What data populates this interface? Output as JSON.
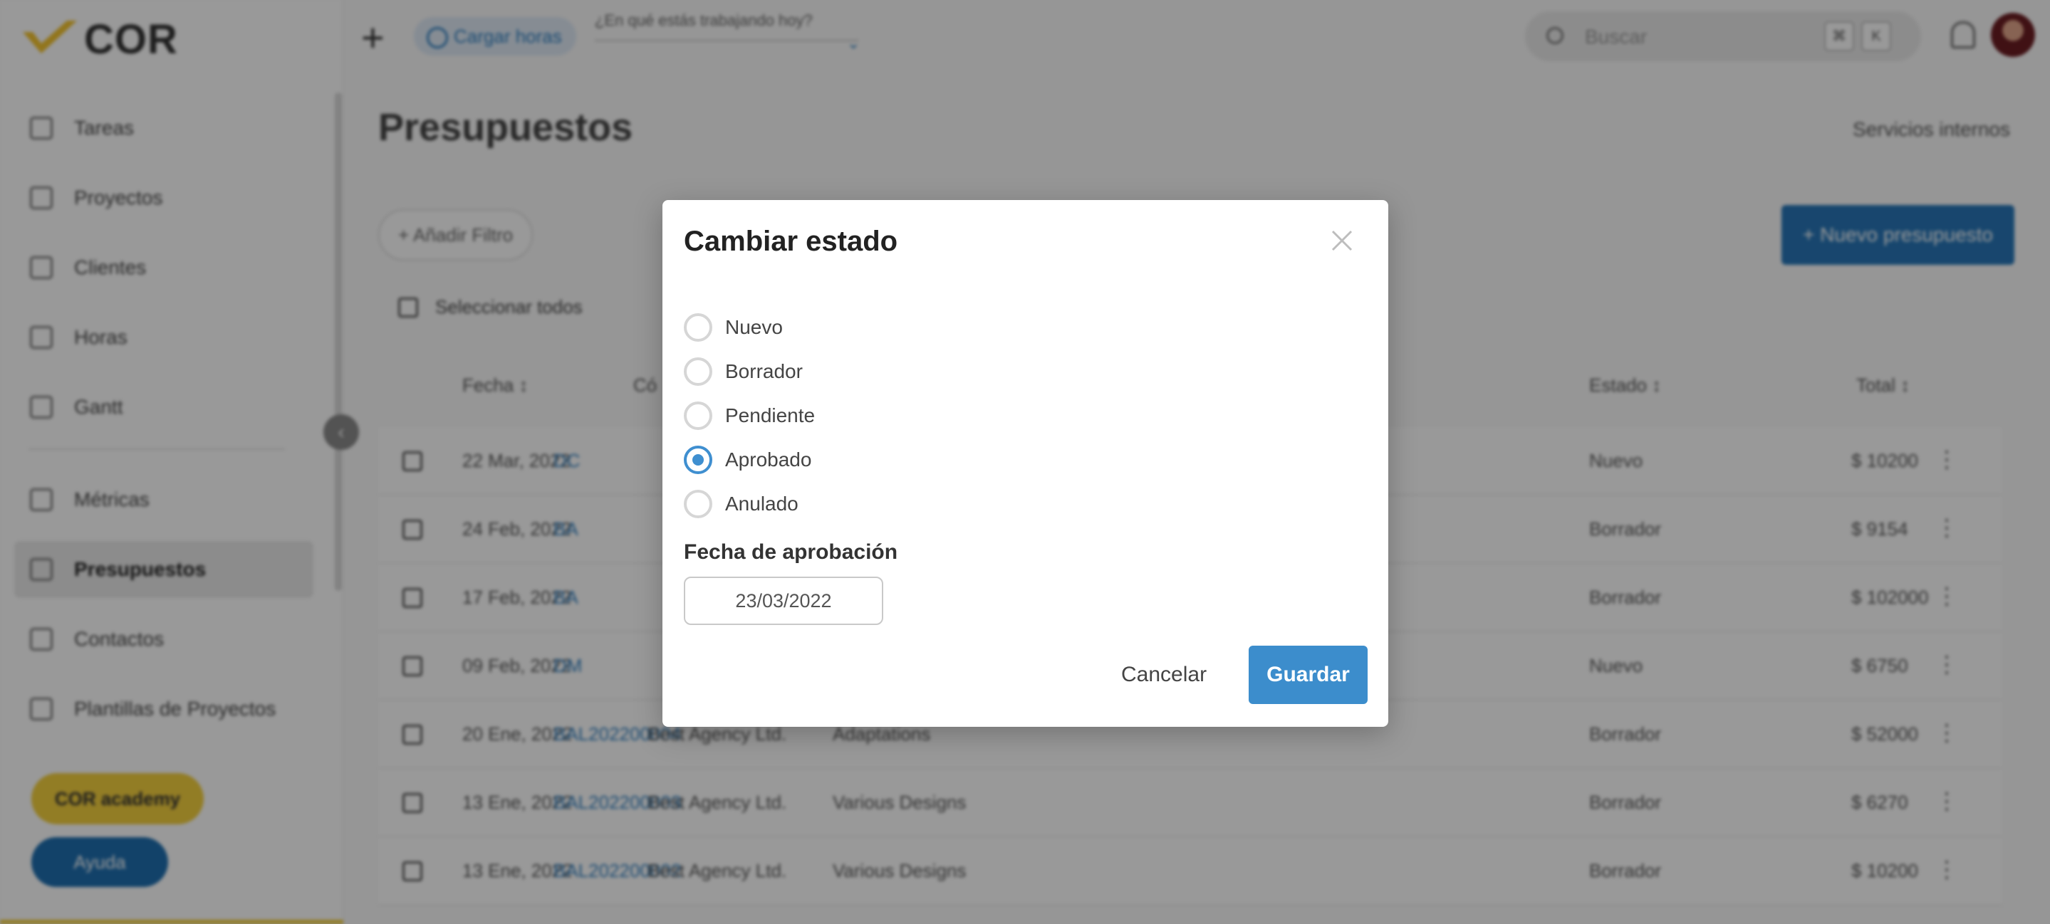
{
  "brand": {
    "logo_text": "COR",
    "accent": "#f4d03f",
    "primary": "#3c8dcc"
  },
  "sidebar": {
    "items": [
      {
        "label": "Tareas",
        "icon": "tasks-icon"
      },
      {
        "label": "Proyectos",
        "icon": "projects-icon"
      },
      {
        "label": "Clientes",
        "icon": "clients-icon"
      },
      {
        "label": "Horas",
        "icon": "hourglass-icon"
      },
      {
        "label": "Gantt",
        "icon": "gantt-icon"
      },
      {
        "label": "Métricas",
        "icon": "metrics-icon"
      },
      {
        "label": "Presupuestos",
        "icon": "budget-icon",
        "active": true
      },
      {
        "label": "Contactos",
        "icon": "contacts-icon"
      },
      {
        "label": "Plantillas de Proyectos",
        "icon": "templates-icon"
      }
    ],
    "academy_label": "COR academy",
    "help_label": "Ayuda"
  },
  "topbar": {
    "cargar_label": "Cargar horas",
    "working_placeholder": "¿En qué estás trabajando hoy?",
    "search_placeholder": "Buscar",
    "kbd_cmd": "⌘",
    "kbd_k": "K"
  },
  "main": {
    "title": "Presupuestos",
    "servicios_label": "Servicios internos",
    "add_filter_label": "+ Añadir Filtro",
    "new_budget_label": "+ Nuevo presupuesto",
    "select_all_label": "Seleccionar todos",
    "columns": {
      "fecha": "Fecha ↕",
      "codigo": "Có",
      "estado": "Estado ↕",
      "total": "Total ↕"
    },
    "rows": [
      {
        "fecha": "22 Mar, 2022",
        "codigo": "DC",
        "cliente": "",
        "proyecto": "",
        "estado": "Nuevo",
        "total": "$ 10200"
      },
      {
        "fecha": "24 Feb, 2022",
        "codigo": "BA",
        "cliente": "",
        "proyecto": "",
        "estado": "Borrador",
        "total": "$ 9154"
      },
      {
        "fecha": "17 Feb, 2022",
        "codigo": "BA",
        "cliente": "",
        "proyecto": "",
        "estado": "Borrador",
        "total": "$ 102000"
      },
      {
        "fecha": "09 Feb, 2022",
        "codigo": "DM",
        "cliente": "",
        "proyecto": "",
        "estado": "Nuevo",
        "total": "$ 6750"
      },
      {
        "fecha": "20 Ene, 2022",
        "codigo": "BAL202200004",
        "cliente": "Best Agency Ltd.",
        "proyecto": "Adaptations",
        "estado": "Borrador",
        "total": "$ 52000"
      },
      {
        "fecha": "13 Ene, 2022",
        "codigo": "BAL202200003",
        "cliente": "Best Agency Ltd.",
        "proyecto": "Various Designs",
        "estado": "Borrador",
        "total": "$ 6270"
      },
      {
        "fecha": "13 Ene, 2022",
        "codigo": "BAL202200002",
        "cliente": "Best Agency Ltd.",
        "proyecto": "Various Designs",
        "estado": "Borrador",
        "total": "$ 10200"
      }
    ]
  },
  "modal": {
    "title": "Cambiar estado",
    "options": [
      {
        "label": "Nuevo",
        "checked": false
      },
      {
        "label": "Borrador",
        "checked": false
      },
      {
        "label": "Pendiente",
        "checked": false
      },
      {
        "label": "Aprobado",
        "checked": true
      },
      {
        "label": "Anulado",
        "checked": false
      }
    ],
    "date_label": "Fecha de aprobación",
    "date_value": "23/03/2022",
    "cancel_label": "Cancelar",
    "save_label": "Guardar"
  }
}
